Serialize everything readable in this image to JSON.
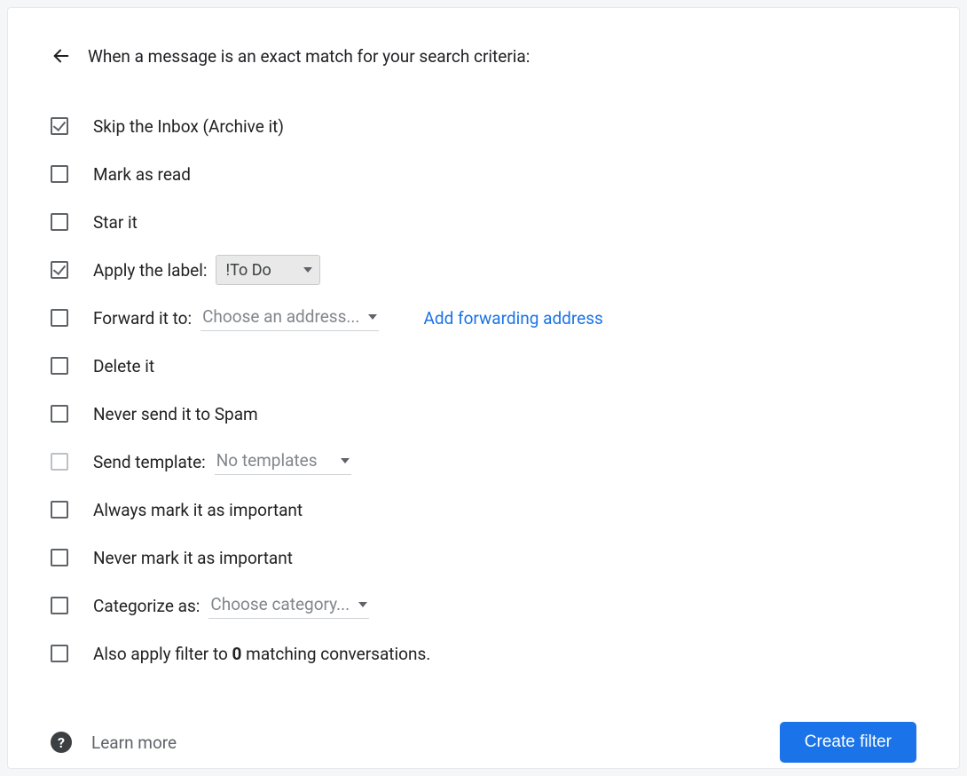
{
  "header": {
    "title": "When a message is an exact match for your search criteria:"
  },
  "options": {
    "skip_inbox": {
      "label": "Skip the Inbox (Archive it)",
      "checked": true
    },
    "mark_read": {
      "label": "Mark as read",
      "checked": false
    },
    "star_it": {
      "label": "Star it",
      "checked": false
    },
    "apply_label": {
      "label": "Apply the label:",
      "checked": true,
      "value": "!To Do"
    },
    "forward": {
      "label": "Forward it to:",
      "checked": false,
      "value": "Choose an address...",
      "link": "Add forwarding address"
    },
    "delete_it": {
      "label": "Delete it",
      "checked": false
    },
    "never_spam": {
      "label": "Never send it to Spam",
      "checked": false
    },
    "send_template": {
      "label": "Send template:",
      "checked": false,
      "value": "No templates",
      "disabled": true
    },
    "always_important": {
      "label": "Always mark it as important",
      "checked": false
    },
    "never_important": {
      "label": "Never mark it as important",
      "checked": false
    },
    "categorize": {
      "label": "Categorize as:",
      "checked": false,
      "value": "Choose category..."
    },
    "apply_existing": {
      "prefix": "Also apply filter to ",
      "count": "0",
      "suffix": " matching conversations.",
      "checked": false
    }
  },
  "footer": {
    "learn_more": "Learn more",
    "create_filter": "Create filter"
  }
}
